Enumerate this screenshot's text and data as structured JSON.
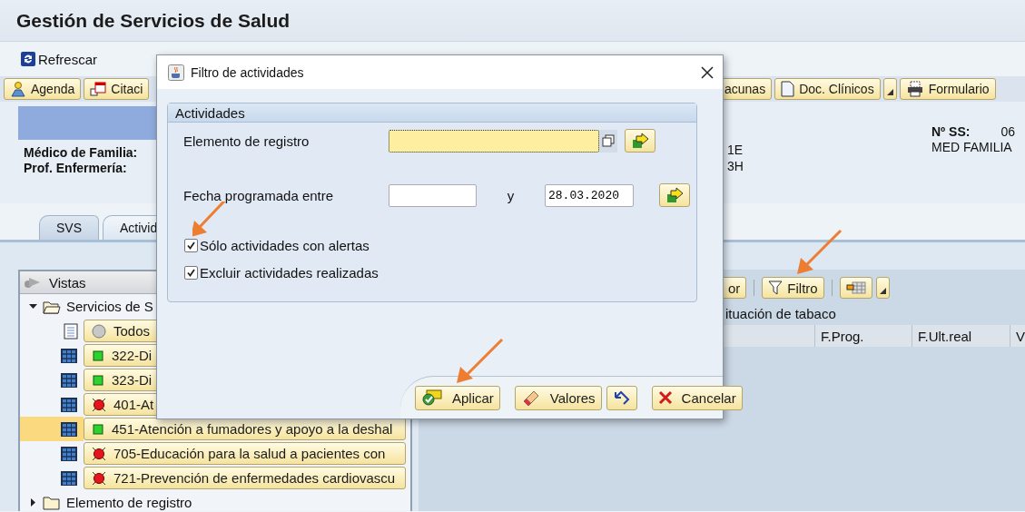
{
  "window": {
    "title": "Gestión de Servicios de Salud"
  },
  "app_toolbar": [
    {
      "label": "Refrescar"
    }
  ],
  "nav_buttons": [
    {
      "label": "Agenda"
    },
    {
      "label": "Citaci"
    }
  ],
  "nav_buttons_right": [
    {
      "label": "acunas"
    },
    {
      "label": "Doc. Clínicos",
      "menu": true
    },
    {
      "label": "Formulario"
    }
  ],
  "header": {
    "labels": [
      "Médico de Familia:",
      "Prof. Enfermería:"
    ],
    "values": [
      "1E",
      "3H"
    ],
    "ss_label": "Nº SS:",
    "ss_value": "06",
    "role": "MED FAMILIA"
  },
  "tabs": [
    {
      "label": "SVS",
      "selected": false
    },
    {
      "label": "Activid",
      "selected": true
    }
  ],
  "tree": {
    "title": "Vistas",
    "nodes": [
      {
        "label": "Servicios de S",
        "kind": "folder",
        "expanded": true,
        "children": [
          {
            "label": "Todos",
            "kind": "list",
            "selected": false
          },
          {
            "label": "322-Di",
            "kind": "table",
            "alert": false,
            "selected": false
          },
          {
            "label": "323-Di",
            "kind": "table",
            "alert": false,
            "selected": false
          },
          {
            "label": "401-At",
            "kind": "table",
            "alert": true,
            "selected": false
          },
          {
            "label": "451-Atención a fumadores y apoyo a la deshal",
            "kind": "table",
            "alert": false,
            "selected": true
          },
          {
            "label": "705-Educación para la salud a pacientes con",
            "kind": "table",
            "alert": true,
            "selected": false
          },
          {
            "label": "721-Prevención de enfermedades cardiovascu",
            "kind": "table",
            "alert": true,
            "selected": false
          }
        ]
      },
      {
        "label": "Elemento de registro",
        "kind": "folder",
        "expanded": false
      }
    ]
  },
  "results": {
    "toolbar": [
      {
        "label": "or"
      },
      {
        "label": "Filtro"
      },
      {
        "menu": true
      }
    ],
    "caption": "ituación de tabaco",
    "columns": [
      "F.Prog.",
      "F.Ult.real",
      "V"
    ]
  },
  "dialog": {
    "title": "Filtro de actividades",
    "group": "Actividades",
    "element_field": {
      "label": "Elemento de registro"
    },
    "date_field": {
      "label": "Fecha programada entre",
      "joiner": "y",
      "to": "28.03.2020"
    },
    "checkboxes": [
      {
        "label": "Sólo actividades con alertas",
        "checked": true
      },
      {
        "label": "Excluir actividades realizadas",
        "checked": true
      }
    ],
    "buttons": [
      {
        "kind": "text",
        "label": "Aplicar"
      },
      {
        "kind": "text",
        "label": "Valores"
      },
      {
        "kind": "icon"
      },
      {
        "kind": "text",
        "label": "Cancelar"
      }
    ]
  }
}
